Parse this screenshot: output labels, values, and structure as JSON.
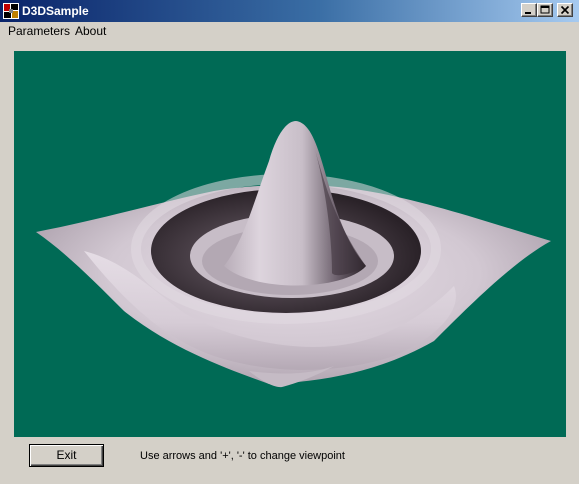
{
  "window": {
    "title": "D3DSample",
    "icon": "app-icon",
    "controls": [
      "minimize-icon",
      "maximize-icon",
      "close-icon"
    ]
  },
  "menu": {
    "items": [
      {
        "label": "Parameters"
      },
      {
        "label": "About"
      }
    ]
  },
  "viewport": {
    "background_color": "#006a55",
    "surface_color": "#d8d0d8"
  },
  "footer": {
    "exit_label": "Exit",
    "hint": "Use arrows and '+', '-' to change viewpoint"
  }
}
